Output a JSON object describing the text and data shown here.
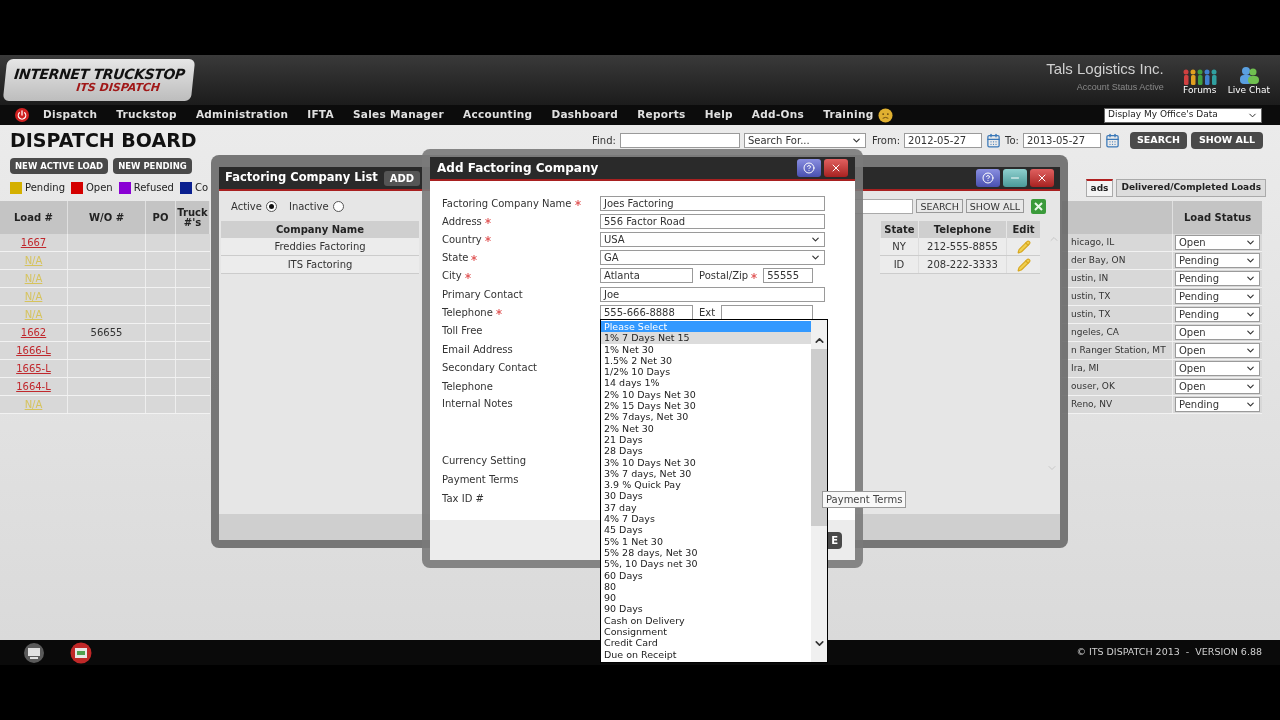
{
  "header": {
    "logo_title": "INTERNET TRUCKSTOP",
    "logo_subtitle": "ITS DISPATCH",
    "company": "Tals Logistics Inc.",
    "account_status": "Account Status Active",
    "links": [
      {
        "label": "Forums",
        "kind": "forums"
      },
      {
        "label": "Live Chat",
        "kind": "chat"
      }
    ]
  },
  "nav": {
    "items": [
      "Dispatch",
      "Truckstop",
      "Administration",
      "IFTA",
      "Sales Manager",
      "Accounting",
      "Dashboard",
      "Reports",
      "Help",
      "Add-Ons",
      "Training"
    ],
    "office_select": "Display My Office's Data"
  },
  "board": {
    "title": "DISPATCH BOARD",
    "buttons": [
      "NEW ACTIVE LOAD",
      "NEW PENDING"
    ],
    "legend": [
      {
        "label": "Pending",
        "color": "#d4b000"
      },
      {
        "label": "Open",
        "color": "#d40000"
      },
      {
        "label": "Refused",
        "color": "#8a00d4"
      },
      {
        "label": "Co",
        "color": "#0a1f8f"
      }
    ],
    "find_label": "Find:",
    "search_for": "Search For...",
    "from_label": "From:",
    "from": "2012-05-27",
    "to_label": "To:",
    "to": "2013-05-27",
    "search_button": "SEARCH",
    "show_all_button": "SHOW ALL",
    "tabs": [
      {
        "label": "ads",
        "selected": true
      },
      {
        "label": "Delivered/Completed Loads",
        "selected": false
      }
    ],
    "columns": [
      "Load #",
      "W/O #",
      "PO",
      "Truck #'s"
    ],
    "right_columns": [
      "Load Status"
    ],
    "rows": [
      {
        "load": "1667",
        "color": "#c0282d",
        "city": "hicago, IL",
        "status": "Open"
      },
      {
        "load": "N/A",
        "color": "#d6c35c",
        "city": "der Bay, ON",
        "status": "Pending"
      },
      {
        "load": "N/A",
        "color": "#d6c35c",
        "city": "ustin, IN",
        "status": "Pending"
      },
      {
        "load": "N/A",
        "color": "#d6c35c",
        "city": "ustin, TX",
        "status": "Pending"
      },
      {
        "load": "N/A",
        "color": "#d6c35c",
        "city": "ustin, TX",
        "status": "Pending"
      },
      {
        "load": "1662",
        "color": "#c0282d",
        "wo": "56655",
        "city": "ngeles, CA",
        "status": "Open"
      },
      {
        "load": "1666-L",
        "color": "#c0282d",
        "city": "n Ranger Station, MT",
        "status": "Open"
      },
      {
        "load": "1665-L",
        "color": "#c0282d",
        "city": "Ira, MI",
        "status": "Open"
      },
      {
        "load": "1664-L",
        "color": "#c0282d",
        "city": "ouser, OK",
        "status": "Open"
      },
      {
        "load": "N/A",
        "color": "#d6c35c",
        "city": "Reno, NV",
        "status": "Pending"
      }
    ]
  },
  "factoring_list": {
    "title": "Factoring Company List",
    "add_button": "ADD",
    "filters": [
      {
        "label": "Active",
        "selected": true
      },
      {
        "label": "Inactive",
        "selected": false
      }
    ],
    "search_button": "SEARCH",
    "show_all_button": "SHOW ALL",
    "columns": [
      "Company Name",
      "State",
      "Telephone",
      "Edit"
    ],
    "rows": [
      {
        "name": "Freddies Factoring",
        "state": "NY",
        "telephone": "212-555-8855"
      },
      {
        "name": "ITS Factoring",
        "state": "ID",
        "telephone": "208-222-3333"
      }
    ]
  },
  "dialog": {
    "title": "Add Factoring Company",
    "fields": [
      {
        "label": "Factoring Company Name",
        "required": true,
        "kind": "text",
        "value": "Joes Factoring"
      },
      {
        "label": "Address",
        "required": true,
        "kind": "text",
        "value": "556 Factor Road"
      },
      {
        "label": "Country",
        "required": true,
        "kind": "select",
        "value": "USA"
      },
      {
        "label": "State",
        "required": true,
        "kind": "select",
        "value": "GA"
      },
      {
        "label": "City",
        "required": true,
        "kind": "pair",
        "value": "Atlanta",
        "label2": "Postal/Zip",
        "required2": true,
        "value2": "55555"
      },
      {
        "label": "Primary Contact",
        "required": false,
        "kind": "text",
        "value": "Joe"
      },
      {
        "label": "Telephone",
        "required": true,
        "kind": "pair",
        "value": "555-666-8888",
        "label2": "Ext",
        "required2": false
      },
      {
        "label": "Toll Free",
        "required": false,
        "kind": "covered"
      },
      {
        "label": "Email Address",
        "required": false,
        "kind": "covered"
      },
      {
        "label": "Secondary Contact",
        "required": false,
        "kind": "covered"
      },
      {
        "label": "Telephone",
        "required": false,
        "kind": "covered"
      },
      {
        "label": "Internal Notes",
        "required": false,
        "kind": "notes"
      },
      {
        "label": "Currency Setting",
        "required": false,
        "kind": "covered"
      },
      {
        "label": "Payment Terms",
        "required": false,
        "kind": "covered"
      },
      {
        "label": "Tax ID #",
        "required": false,
        "kind": "covered"
      }
    ],
    "save_button": "E",
    "dropdown": [
      {
        "label": "Please Select",
        "selected": true,
        "hovered": false
      },
      {
        "label": "1% 7 Days Net 15",
        "selected": false,
        "hovered": true
      },
      {
        "label": "1% Net 30",
        "selected": false,
        "hovered": false
      },
      {
        "label": "1.5% 2 Net 30",
        "selected": false,
        "hovered": false
      },
      {
        "label": "1/2% 10 Days",
        "selected": false,
        "hovered": false
      },
      {
        "label": "14 days 1%",
        "selected": false,
        "hovered": false
      },
      {
        "label": "2% 10 Days Net 30",
        "selected": false,
        "hovered": false
      },
      {
        "label": "2% 15 Days Net 30",
        "selected": false,
        "hovered": false
      },
      {
        "label": "2% 7days, Net 30",
        "selected": false,
        "hovered": false
      },
      {
        "label": "2% Net 30",
        "selected": false,
        "hovered": false
      },
      {
        "label": "21 Days",
        "selected": false,
        "hovered": false
      },
      {
        "label": "28 Days",
        "selected": false,
        "hovered": false
      },
      {
        "label": "3% 10 Days Net 30",
        "selected": false,
        "hovered": false
      },
      {
        "label": "3% 7 days, Net 30",
        "selected": false,
        "hovered": false
      },
      {
        "label": "3.9 % Quick Pay",
        "selected": false,
        "hovered": false
      },
      {
        "label": "30 Days",
        "selected": false,
        "hovered": false
      },
      {
        "label": "37 day",
        "selected": false,
        "hovered": false
      },
      {
        "label": "4% 7 Days",
        "selected": false,
        "hovered": false
      },
      {
        "label": "45 Days",
        "selected": false,
        "hovered": false
      },
      {
        "label": "5% 1 Net 30",
        "selected": false,
        "hovered": false
      },
      {
        "label": "5% 28 days, Net 30",
        "selected": false,
        "hovered": false
      },
      {
        "label": "5%, 10 Days net 30",
        "selected": false,
        "hovered": false
      },
      {
        "label": "60 Days",
        "selected": false,
        "hovered": false
      },
      {
        "label": "80",
        "selected": false,
        "hovered": false
      },
      {
        "label": "90",
        "selected": false,
        "hovered": false
      },
      {
        "label": "90 Days",
        "selected": false,
        "hovered": false
      },
      {
        "label": "Cash on Delivery",
        "selected": false,
        "hovered": false
      },
      {
        "label": "Consignment",
        "selected": false,
        "hovered": false
      },
      {
        "label": "Credit Card",
        "selected": false,
        "hovered": false
      },
      {
        "label": "Due on Receipt",
        "selected": false,
        "hovered": false
      }
    ],
    "tooltip": "Payment Terms"
  },
  "footer": {
    "copyright": "© ITS DISPATCH 2013  -  VERSION 6.88"
  }
}
